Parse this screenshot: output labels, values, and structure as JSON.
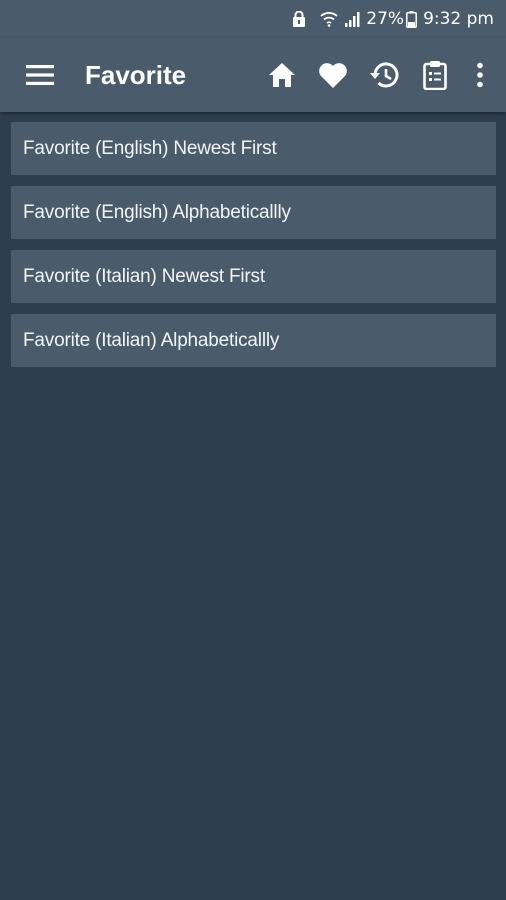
{
  "status_bar": {
    "battery_percent": "27%",
    "time": "9:32 pm",
    "icons": [
      "lock-icon",
      "wifi-icon",
      "signal-icon",
      "battery-icon"
    ]
  },
  "app_bar": {
    "title": "Favorite",
    "icons": [
      "menu-icon",
      "home-icon",
      "heart-icon",
      "history-icon",
      "clipboard-icon",
      "more-vert-icon"
    ]
  },
  "list": {
    "items": [
      {
        "label": "Favorite (English) Newest First"
      },
      {
        "label": "Favorite (English) Alphabeticallly"
      },
      {
        "label": "Favorite (Italian) Newest First"
      },
      {
        "label": "Favorite (Italian) Alphabeticallly"
      }
    ]
  },
  "colors": {
    "background": "#2e3e4e",
    "bar": "#4a5b6b",
    "item": "#4a5b6b",
    "text": "#ffffff"
  }
}
